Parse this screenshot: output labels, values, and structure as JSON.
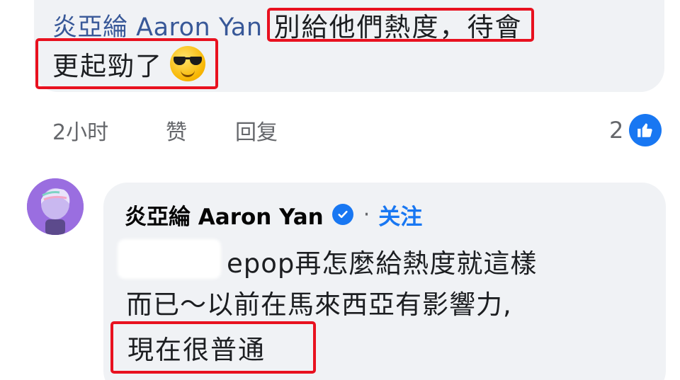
{
  "comment": {
    "author": "炎亞綸 Aaron Yan",
    "text_highlight_1": "別給他們熱度，待會",
    "text_highlight_2": "更起勁了",
    "emoji": "smiling-face-with-sunglasses",
    "time": "2小时",
    "like_label": "赞",
    "reply_label": "回复",
    "reaction_count": "2"
  },
  "reply": {
    "author": "炎亞綸 Aaron Yan",
    "separator": "·",
    "follow_label": "关注",
    "line_1": "epop再怎麼給熱度就這樣",
    "line_2": "而已～以前在馬來西亞有影響力,",
    "line_3_highlight": "現在很普通"
  },
  "colors": {
    "highlight_box": "#e8111f",
    "author_link": "#385898",
    "bubble": "#f0f2f5",
    "facebook_blue": "#1877f2",
    "meta_gray": "#65676b"
  }
}
